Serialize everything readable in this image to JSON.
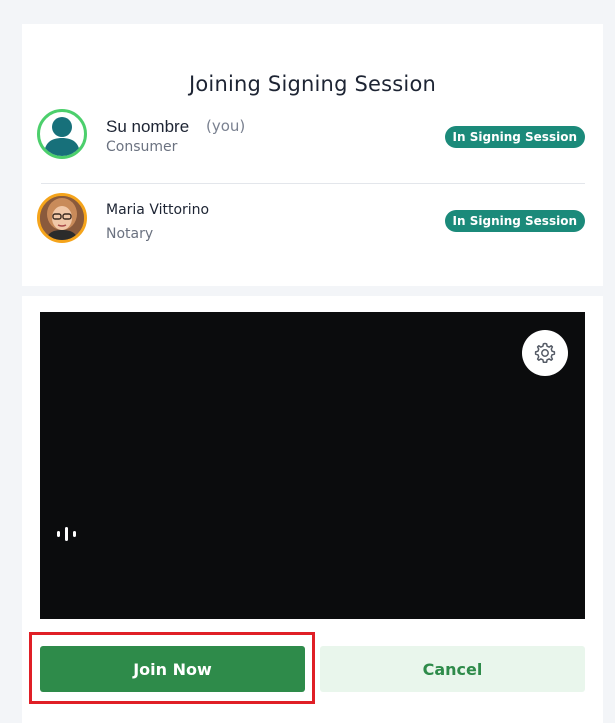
{
  "title": "Joining Signing Session",
  "participants": [
    {
      "name": "Su nombre",
      "you_tag": "(you)",
      "role": "Consumer",
      "status": "In Signing Session",
      "avatar": "person-silhouette-icon",
      "ring_color": "#4ccf6c"
    },
    {
      "name": "Maria Vittorino",
      "role": "Notary",
      "status": "In Signing Session",
      "avatar": "notary-photo",
      "ring_color": "#f5a41b"
    }
  ],
  "video": {
    "settings_icon": "gear-icon",
    "mic_icon": "audio-level-icon"
  },
  "actions": {
    "join_label": "Join Now",
    "cancel_label": "Cancel"
  },
  "colors": {
    "primary_green": "#2e8b4a",
    "badge_teal": "#1b8a7a",
    "highlight_red": "#e01f26"
  }
}
